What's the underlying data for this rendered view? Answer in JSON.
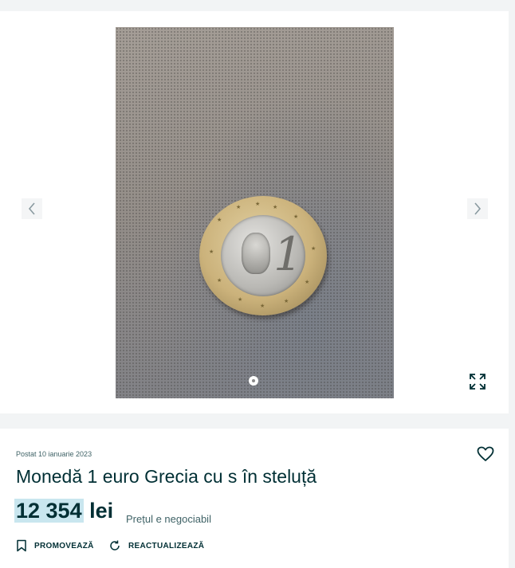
{
  "gallery": {
    "prev_icon": "chevron-left-icon",
    "next_icon": "chevron-right-icon",
    "fullscreen_icon": "expand-icon",
    "image_count": 1,
    "active_index": 1
  },
  "listing": {
    "posted": "Postat 10 ianuarie 2023",
    "title": "Monedă 1 euro Grecia cu s în steluță",
    "price_amount": "12 354",
    "price_currency": "lei",
    "negotiable": "Prețul e negociabil",
    "favorite_icon": "heart-icon"
  },
  "actions": {
    "promote_label": "PROMOVEAZĂ",
    "promote_icon": "bookmark-icon",
    "refresh_label": "REACTUALIZEAZĂ",
    "refresh_icon": "refresh-icon"
  },
  "colors": {
    "text": "#002f34",
    "price_highlight": "#c9e6ef",
    "background": "#f2f4f5"
  }
}
